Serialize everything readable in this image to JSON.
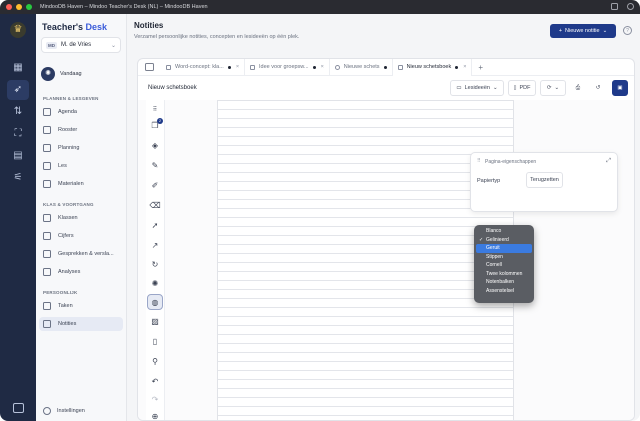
{
  "window": {
    "title": "MindooDB Haven – Mindoo Teacher's Desk (NL) – MindooDB Haven"
  },
  "brand": {
    "name_a": "Teacher's",
    "name_b": "Desk"
  },
  "user": {
    "initials": "MD",
    "name": "M. de Vries"
  },
  "today": {
    "label": "Vandaag"
  },
  "sections": {
    "planning": "PLANNEN & LESGEVEN",
    "class": "KLAS & VOORTGANG",
    "personal": "PERSOONLIJK"
  },
  "nav": {
    "agenda": "Agenda",
    "rooster": "Rooster",
    "planning": "Planning",
    "les": "Les",
    "materialen": "Materialen",
    "klassen": "Klassen",
    "cijfers": "Cijfers",
    "gesprekken": "Gesprekken & versla...",
    "analyses": "Analyses",
    "taken": "Taken",
    "notities": "Notities",
    "instellingen": "Instellingen"
  },
  "page": {
    "title": "Notities",
    "subtitle": "Verzamel persoonlijke notities, concepten en lesideeën op één plek."
  },
  "new_note": {
    "label": "Nieuwe notitie"
  },
  "help_icon": "?",
  "tabs": [
    {
      "label": "Word-concept: kla...",
      "dirty": true
    },
    {
      "label": "Idee voor groepsw...",
      "dirty": true
    },
    {
      "label": "Nieuwe schets",
      "dirty": true
    },
    {
      "label": "Nieuw schetsboek",
      "dirty": true
    }
  ],
  "doc": {
    "name": "Nieuw schetsboek"
  },
  "toolbar": {
    "category": "Lesideeën",
    "pdf": "PDF"
  },
  "tools_badge": "2",
  "page_props": {
    "title": "Pagina-eigenschappen",
    "paper_label": "Papiertyp",
    "reset": "Terugzetten"
  },
  "paper_options": [
    {
      "label": "Blanco",
      "checked": false,
      "highlighted": false
    },
    {
      "label": "Gelinieerd",
      "checked": true,
      "highlighted": false
    },
    {
      "label": "Geruit",
      "checked": false,
      "highlighted": true
    },
    {
      "label": "Stippen",
      "checked": false,
      "highlighted": false
    },
    {
      "label": "Cornell",
      "checked": false,
      "highlighted": false
    },
    {
      "label": "Twee kolommen",
      "checked": false,
      "highlighted": false
    },
    {
      "label": "Notenbalken",
      "checked": false,
      "highlighted": false
    },
    {
      "label": "Assenstelsel",
      "checked": false,
      "highlighted": false
    }
  ],
  "colors": {
    "rail": "#1f2a44",
    "accent": "#1f3a8a",
    "highlight": "#3b7be0"
  }
}
